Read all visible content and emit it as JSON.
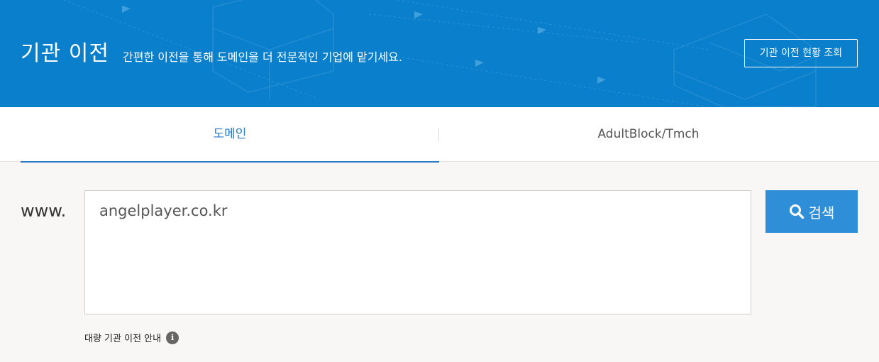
{
  "header": {
    "title": "기관 이전",
    "subtitle": "간편한 이전을 통해 도메인을 더 전문적인 기업에 맡기세요.",
    "status_button_label": "기관 이전 현황 조회",
    "background_color": "#0a7fcb"
  },
  "tabs": [
    {
      "label": "도메인",
      "active": true
    },
    {
      "label": "AdultBlock/Tmch",
      "active": false
    }
  ],
  "search": {
    "prefix_label": "www.",
    "input_value": "angelplayer.co.kr",
    "button_label": "검색",
    "button_icon": "search-icon",
    "accent_color": "#2f8ed8"
  },
  "bulk_guide": {
    "label": "대량 기관 이전 안내",
    "icon": "info-icon",
    "icon_glyph": "i"
  }
}
